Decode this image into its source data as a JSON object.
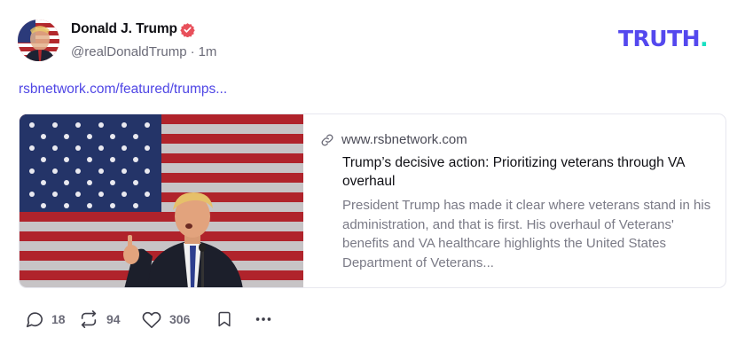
{
  "brand": {
    "logo_main": "TRUTH",
    "logo_dot": ".",
    "primary_color": "#5448ee",
    "accent_color": "#17e0c1"
  },
  "post": {
    "author": {
      "name": "Donald J. Trump",
      "handle": "@realDonaldTrump",
      "separator": "·",
      "time": "1m",
      "verified_icon": "verified-badge-icon"
    },
    "link_text": "rsbnetwork.com/featured/trumps...",
    "card": {
      "domain": "www.rsbnetwork.com",
      "title": "Trump’s decisive action: Prioritizing veterans through VA overhaul",
      "description": "President Trump has made it clear where veterans stand in his administration, and that is first. His overhaul of Veterans' benefits and VA healthcare highlights the United States Department of Veterans..."
    },
    "actions": {
      "replies": "18",
      "retruths": "94",
      "likes": "306",
      "icons": [
        "reply-icon",
        "retruth-icon",
        "heart-icon",
        "bookmark-icon",
        "more-icon"
      ]
    }
  }
}
